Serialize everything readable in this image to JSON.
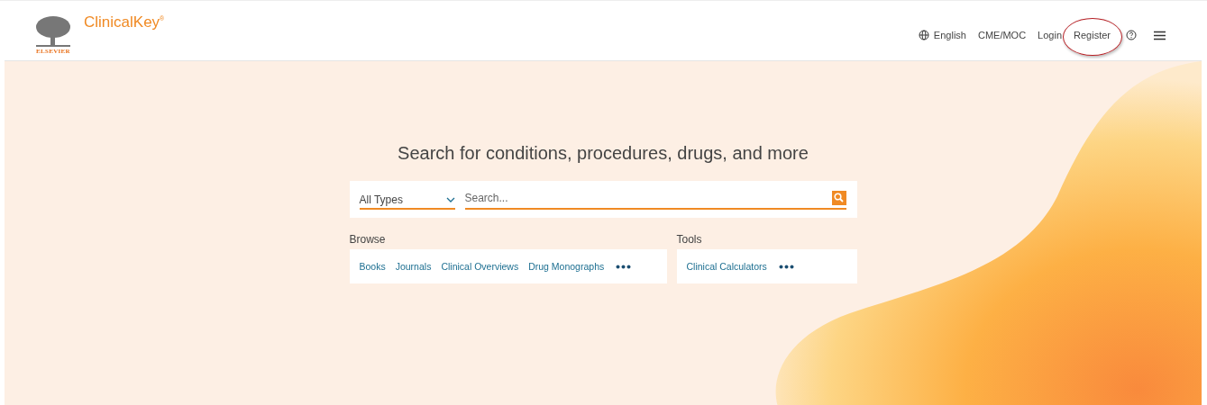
{
  "header": {
    "brand": "ClinicalKey$^{®}$",
    "publisher": "ELSEVIER",
    "nav": [
      {
        "kind": "language",
        "label": "English"
      },
      {
        "kind": "link",
        "label": "CME/MOC"
      },
      {
        "kind": "link",
        "label": "Login"
      },
      {
        "kind": "link",
        "label": "Register",
        "highlighted": true
      },
      {
        "kind": "help"
      },
      {
        "kind": "menu"
      }
    ]
  },
  "hero": {
    "heading": "Search for conditions, procedures, drugs, and more",
    "search": {
      "type_select": "All Types",
      "placeholder": "Search..."
    },
    "sections": [
      {
        "title": "Browse",
        "links": [
          "Books",
          "Journals",
          "Clinical Overviews",
          "Drug Monographs"
        ]
      },
      {
        "title": "Tools",
        "links": [
          "Clinical Calculators"
        ]
      }
    ]
  }
}
